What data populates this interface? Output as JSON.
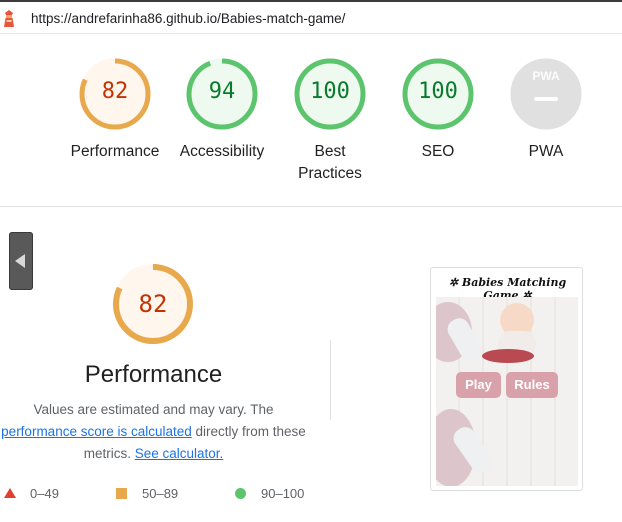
{
  "url_bar": {
    "url": "https://andrefarinha86.github.io/Babies-match-game/"
  },
  "gauges": [
    {
      "score": "82",
      "label": "Performance",
      "color": "#e8a84c",
      "fraction": 0.82,
      "text_color": "#c33300",
      "bg": "#fff6ee"
    },
    {
      "score": "94",
      "label": "Accessibility",
      "color": "#5cc46d",
      "fraction": 0.94,
      "text_color": "#0a7a2b",
      "bg": "#eef9f0"
    },
    {
      "score": "100",
      "label": "Best Practices",
      "color": "#5cc46d",
      "fraction": 1.0,
      "text_color": "#0a7a2b",
      "bg": "#eef9f0"
    },
    {
      "score": "100",
      "label": "SEO",
      "color": "#5cc46d",
      "fraction": 1.0,
      "text_color": "#0a7a2b",
      "bg": "#eef9f0"
    },
    {
      "score": "PWA",
      "label": "PWA",
      "color": "#e0e0e0",
      "fraction": 1.0,
      "text_color": "#9e9e9e",
      "bg": "#e0e0e0"
    }
  ],
  "detail": {
    "score": "82",
    "fraction": 0.82,
    "title": "Performance",
    "desc_line1": "Values are estimated and may vary. The",
    "desc_link1": "performance score is calculated",
    "desc_mid": " directly from these",
    "desc_line3_pre": "metrics. ",
    "desc_link2": "See calculator."
  },
  "legend": [
    {
      "range": "0–49",
      "shape": "triangle",
      "color": "#e0402e"
    },
    {
      "range": "50–89",
      "shape": "square",
      "color": "#e8a84c"
    },
    {
      "range": "90–100",
      "shape": "circle",
      "color": "#5cc46d"
    }
  ],
  "preview": {
    "title": "Babies Matching Game",
    "play_label": "Play",
    "rules_label": "Rules"
  }
}
